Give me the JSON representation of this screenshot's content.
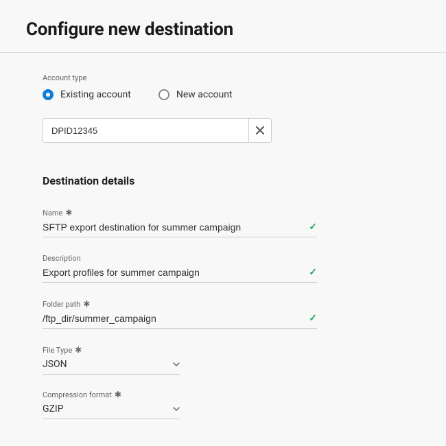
{
  "page_title": "Configure new destination",
  "account_type": {
    "label": "Account type",
    "options": {
      "existing": "Existing account",
      "new": "New account"
    },
    "selected_value": "DPID12345"
  },
  "destination_details": {
    "section_title": "Destination details",
    "name": {
      "label": "Name",
      "value": "SFTP export destination for summer campaign"
    },
    "description": {
      "label": "Description",
      "value": "Export profiles for summer campaign"
    },
    "folder_path": {
      "label": "Folder path",
      "value": "/ftp_dir/summer_campaign"
    },
    "file_type": {
      "label": "File Type",
      "value": "JSON"
    },
    "compression_format": {
      "label": "Compression format",
      "value": "GZIP"
    }
  }
}
